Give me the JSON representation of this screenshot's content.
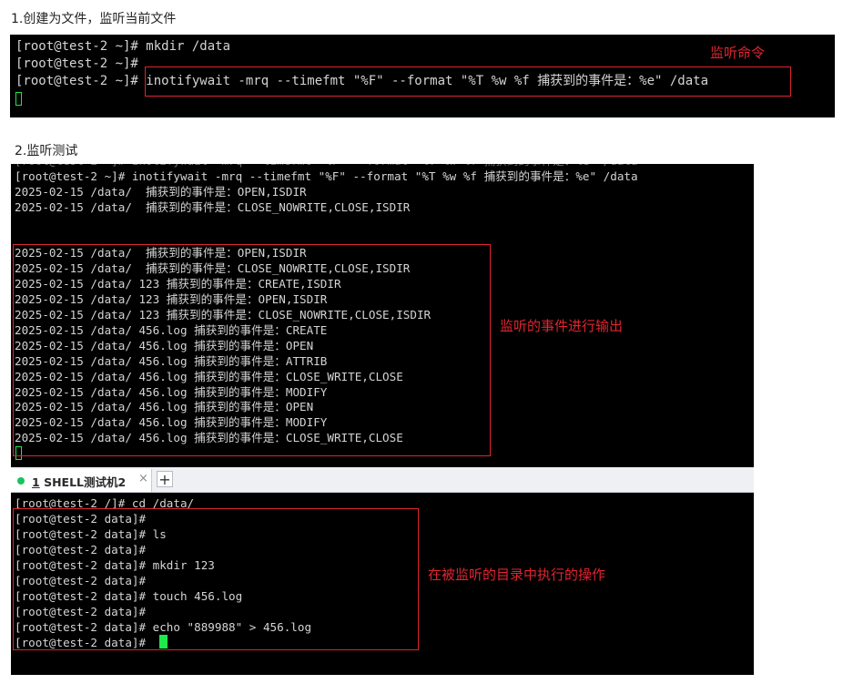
{
  "section1": {
    "heading": "1.创建为文件，监听当前文件",
    "lines": [
      "[root@test-2 ~]# mkdir /data",
      "[root@test-2 ~]#",
      "[root@test-2 ~]# inotifywait -mrq --timefmt \"%F\" --format \"%T %w %f 捕获到的事件是：%e\" /data"
    ],
    "annotation": "监听命令"
  },
  "section2": {
    "heading": "2.监听测试",
    "lines": [
      "[root@test-2 ~]# inotifywait -mrq --timefmt \"%F\" --format \"%T %w %f 捕获到的事件是：%e\" /data",
      "2025-02-15 /data/  捕获到的事件是：OPEN,ISDIR",
      "2025-02-15 /data/  捕获到的事件是：CLOSE_NOWRITE,CLOSE,ISDIR",
      "",
      "",
      "2025-02-15 /data/  捕获到的事件是：OPEN,ISDIR",
      "2025-02-15 /data/  捕获到的事件是：CLOSE_NOWRITE,CLOSE,ISDIR",
      "2025-02-15 /data/ 123 捕获到的事件是：CREATE,ISDIR",
      "2025-02-15 /data/ 123 捕获到的事件是：OPEN,ISDIR",
      "2025-02-15 /data/ 123 捕获到的事件是：CLOSE_NOWRITE,CLOSE,ISDIR",
      "2025-02-15 /data/ 456.log 捕获到的事件是：CREATE",
      "2025-02-15 /data/ 456.log 捕获到的事件是：OPEN",
      "2025-02-15 /data/ 456.log 捕获到的事件是：ATTRIB",
      "2025-02-15 /data/ 456.log 捕获到的事件是：CLOSE_WRITE,CLOSE",
      "2025-02-15 /data/ 456.log 捕获到的事件是：MODIFY",
      "2025-02-15 /data/ 456.log 捕获到的事件是：OPEN",
      "2025-02-15 /data/ 456.log 捕获到的事件是：MODIFY",
      "2025-02-15 /data/ 456.log 捕获到的事件是：CLOSE_WRITE,CLOSE"
    ],
    "annotation": "监听的事件进行输出"
  },
  "tab": {
    "number": "1",
    "title": "SHELL测试机2",
    "close_glyph": "×",
    "add_glyph": "+",
    "status_color": "#19c35c"
  },
  "section3": {
    "lines": [
      "[root@test-2 /]# cd /data/",
      "[root@test-2 data]#",
      "[root@test-2 data]# ls",
      "[root@test-2 data]#",
      "[root@test-2 data]# mkdir 123",
      "[root@test-2 data]#",
      "[root@test-2 data]# touch 456.log",
      "[root@test-2 data]#",
      "[root@test-2 data]# echo \"889988\" > 456.log",
      "[root@test-2 data]#"
    ],
    "annotation": "在被监听的目录中执行的操作"
  },
  "colors": {
    "terminal_bg": "#000000",
    "terminal_text": "#d4d4d4",
    "highlight_red": "#e0242f",
    "cursor_green": "#1ee84a"
  }
}
